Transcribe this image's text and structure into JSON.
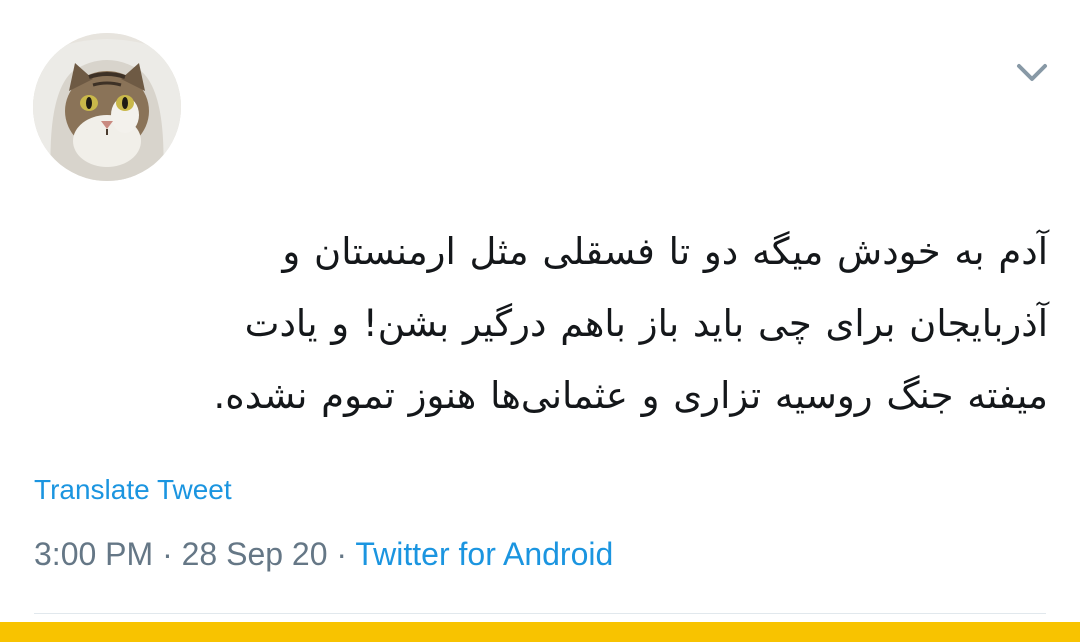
{
  "tweet": {
    "text_lines": [
      "آدم به خودش میگه دو تا فسقلی مثل ارمنستان و",
      "آذربایجان برای چی باید باز باهم درگیر بشن! و یادت",
      "میفته جنگ روسیه تزاری و عثمانی‌ها هنوز تموم نشده."
    ],
    "translate_label": "Translate Tweet",
    "time": "3:00 PM",
    "separator": "·",
    "date": "28 Sep 20",
    "source": "Twitter for Android"
  },
  "icons": {
    "avatar": "cat-avatar",
    "menu": "chevron-down-icon"
  },
  "colors": {
    "link": "#1b95e0",
    "text": "#14171a",
    "meta": "#657786",
    "divider": "#e1e8ed",
    "bottom_bar": "#f8c300"
  }
}
